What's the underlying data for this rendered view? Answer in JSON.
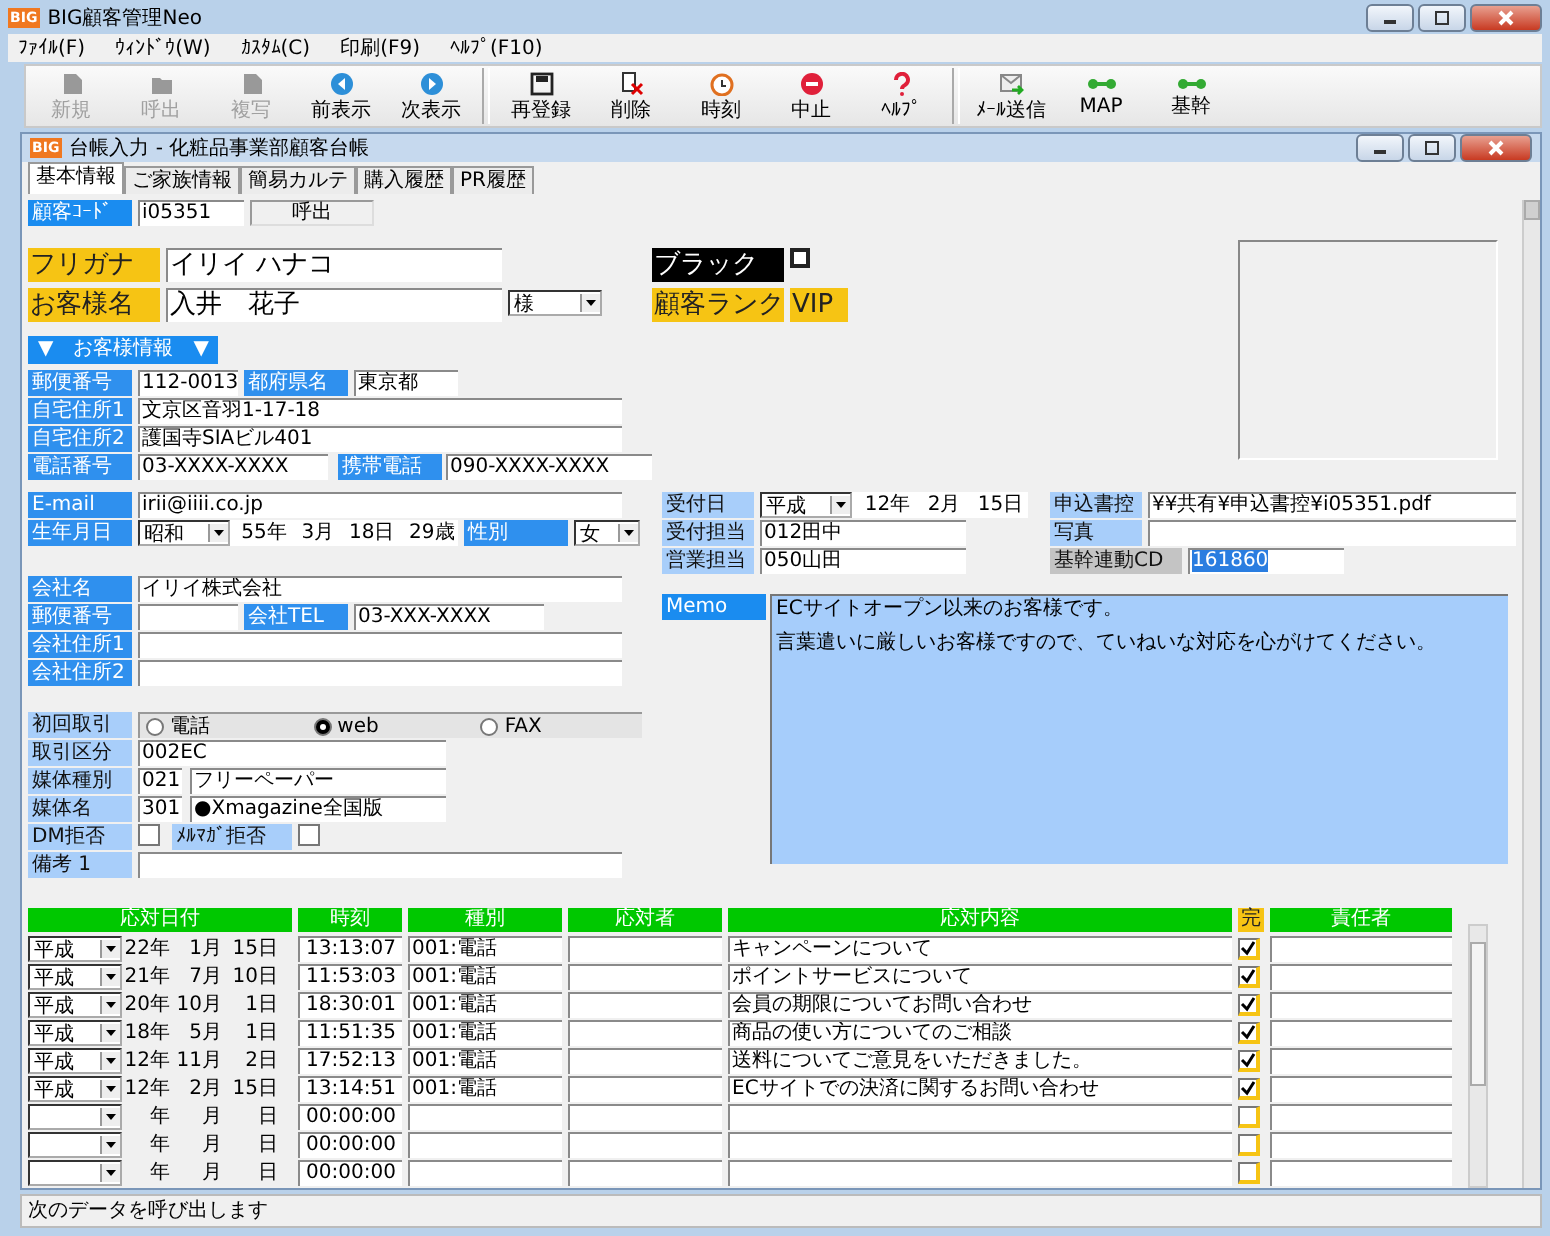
{
  "window": {
    "title": "BIG顧客管理Neo",
    "logo": "BIG"
  },
  "menu": [
    "ﾌｧｲﾙ(F)",
    "ｳｨﾝﾄﾞｳ(W)",
    "ｶｽﾀﾑ(C)",
    "印刷(F9)",
    "ﾍﾙﾌﾟ(F10)"
  ],
  "toolbar": [
    [
      {
        "label": "新規",
        "kind": "doc",
        "disabled": true
      },
      {
        "label": "呼出",
        "kind": "folder",
        "disabled": true
      },
      {
        "label": "複写",
        "kind": "doc",
        "disabled": true
      },
      {
        "label": "前表示",
        "kind": "prev",
        "disabled": false
      },
      {
        "label": "次表示",
        "kind": "next",
        "disabled": false
      }
    ],
    [
      {
        "label": "再登録",
        "kind": "save",
        "disabled": false
      },
      {
        "label": "削除",
        "kind": "delete",
        "disabled": false
      },
      {
        "label": "時刻",
        "kind": "clock",
        "disabled": false
      },
      {
        "label": "中止",
        "kind": "stop",
        "disabled": false
      },
      {
        "label": "ﾍﾙﾌﾟ",
        "kind": "help",
        "disabled": false
      }
    ],
    [
      {
        "label": "ﾒｰﾙ送信",
        "kind": "mail",
        "disabled": false
      },
      {
        "label": "MAP",
        "kind": "link",
        "disabled": false
      },
      {
        "label": "基幹",
        "kind": "link",
        "disabled": false
      }
    ]
  ],
  "inner_window": {
    "title": "台帳入力 - 化粧品事業部顧客台帳",
    "logo": "BIG"
  },
  "tabs": [
    {
      "label": "基本情報",
      "selected": true
    },
    {
      "label": "ご家族情報",
      "selected": false
    },
    {
      "label": "簡易カルテ",
      "selected": false
    },
    {
      "label": "購入履歴",
      "selected": false
    },
    {
      "label": "PR履歴",
      "selected": false
    }
  ],
  "form": {
    "customer_code": {
      "label": "顧客ｺｰﾄﾞ",
      "value": "i05351"
    },
    "call_button": "呼出",
    "furigana": {
      "label": "フリガナ",
      "value": "イリイ ハナコ"
    },
    "name": {
      "label": "お客様名",
      "value": "入井　花子",
      "honorific": "様"
    },
    "blacklist": {
      "label": "ブラック",
      "checked": false
    },
    "rank": {
      "label": "顧客ランク",
      "value": "VIP"
    },
    "section_header": "▼　お客様情報　▼",
    "postal": {
      "label": "郵便番号",
      "value": "112-0013"
    },
    "prefecture": {
      "label": "都府県名",
      "value": "東京都"
    },
    "address1": {
      "label": "自宅住所1",
      "value": "文京区音羽1-17-18"
    },
    "address2": {
      "label": "自宅住所2",
      "value": "護国寺SIAビル401"
    },
    "phone": {
      "label": "電話番号",
      "value": "03-XXXX-XXXX"
    },
    "mobile": {
      "label": "携帯電話",
      "value": "090-XXXX-XXXX"
    },
    "email": {
      "label": "E-mail",
      "value": "irii@iiii.co.jp"
    },
    "birth": {
      "label": "生年月日",
      "era": "昭和",
      "year": "55年",
      "month": "3月",
      "day": "18日",
      "age": "29歳"
    },
    "gender": {
      "label": "性別",
      "value": "女"
    },
    "company": {
      "label": "会社名",
      "value": "イリイ株式会社"
    },
    "company_postal": {
      "label": "郵便番号"
    },
    "company_tel": {
      "label": "会社TEL",
      "value": "03-XXX-XXXX"
    },
    "company_address1": {
      "label": "会社住所1"
    },
    "company_address2": {
      "label": "会社住所2"
    },
    "first_contact": {
      "label": "初回取引",
      "options": [
        {
          "label": "電話",
          "selected": false
        },
        {
          "label": "web",
          "selected": true
        },
        {
          "label": "FAX",
          "selected": false
        }
      ]
    },
    "deal_type": {
      "label": "取引区分",
      "value": "002EC"
    },
    "media_type": {
      "label": "媒体種別",
      "code": "021",
      "value": "フリーペーパー"
    },
    "media_name": {
      "label": "媒体名",
      "code": "301",
      "value": "●Xmagazine全国版"
    },
    "dm_refusal": {
      "label": "DM拒否",
      "checked": false
    },
    "mail_refusal": {
      "label": "ﾒﾙﾏｶﾞ拒否",
      "checked": false
    },
    "note": {
      "label": "備考 1"
    },
    "reception_date": {
      "label": "受付日",
      "era": "平成",
      "year": "12年",
      "month": "2月",
      "day": "15日"
    },
    "reception_staff": {
      "label": "受付担当",
      "value": "012田中"
    },
    "sales_staff": {
      "label": "営業担当",
      "value": "050山田"
    },
    "application": {
      "label": "申込書控",
      "value": "¥¥共有¥申込書控¥i05351.pdf"
    },
    "photo": {
      "label": "写真"
    },
    "core_cd": {
      "label": "基幹連動CD",
      "value": "161860"
    },
    "memo": {
      "label": "Memo",
      "lines": [
        "ECサイトオープン以来のお客様です。",
        "言葉遣いに厳しいお客様ですので、ていねいな対応を心がけてください。"
      ]
    }
  },
  "history": {
    "columns": [
      "応対日付",
      "時刻",
      "種別",
      "応対者",
      "応対内容",
      "完",
      "責任者"
    ],
    "rows": [
      {
        "era": "平成",
        "year": "22年",
        "month": "1月",
        "day": "15日",
        "time": "13:13:07",
        "type": "001:電話",
        "content": "キャンペーンについて",
        "done": true
      },
      {
        "era": "平成",
        "year": "21年",
        "month": "7月",
        "day": "10日",
        "time": "11:53:03",
        "type": "001:電話",
        "content": "ポイントサービスについて",
        "done": true
      },
      {
        "era": "平成",
        "year": "20年",
        "month": "10月",
        "day": "1日",
        "time": "18:30:01",
        "type": "001:電話",
        "content": "会員の期限についてお問い合わせ",
        "done": true
      },
      {
        "era": "平成",
        "year": "18年",
        "month": "5月",
        "day": "1日",
        "time": "11:51:35",
        "type": "001:電話",
        "content": "商品の使い方についてのご相談",
        "done": true
      },
      {
        "era": "平成",
        "year": "12年",
        "month": "11月",
        "day": "2日",
        "time": "17:52:13",
        "type": "001:電話",
        "content": "送料についてご意見をいただきました。",
        "done": true
      },
      {
        "era": "平成",
        "year": "12年",
        "month": "2月",
        "day": "15日",
        "time": "13:14:51",
        "type": "001:電話",
        "content": "ECサイトでの決済に関するお問い合わせ",
        "done": true
      },
      {
        "year": "年",
        "month": "月",
        "day": "日",
        "time": "00:00:00",
        "done": false
      },
      {
        "year": "年",
        "month": "月",
        "day": "日",
        "time": "00:00:00",
        "done": false
      },
      {
        "year": "年",
        "month": "月",
        "day": "日",
        "time": "00:00:00",
        "done": false
      }
    ]
  },
  "status_bar": "次のデータを呼び出します"
}
